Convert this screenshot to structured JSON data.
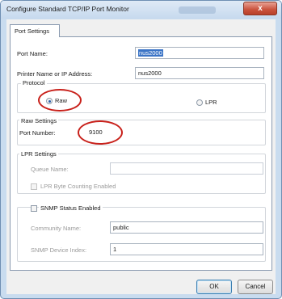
{
  "window": {
    "title": "Configure Standard TCP/IP Port Monitor",
    "close_glyph": "x"
  },
  "tabs": [
    {
      "label": "Port Settings",
      "selected": true
    }
  ],
  "port_settings": {
    "port_name_label": "Port Name:",
    "port_name_value": "nus2000",
    "printer_label": "Printer Name or IP Address:",
    "printer_value": "nus2000"
  },
  "protocol": {
    "group_title": "Protocol",
    "options": [
      {
        "label": "Raw",
        "selected": true
      },
      {
        "label": "LPR",
        "selected": false
      }
    ]
  },
  "raw_settings": {
    "group_title": "Raw Settings",
    "port_number_label": "Port Number:",
    "port_number_value": "9100"
  },
  "lpr_settings": {
    "group_title": "LPR Settings",
    "queue_name_label": "Queue Name:",
    "queue_name_value": "",
    "byte_counting_label": "LPR Byte Counting Enabled",
    "byte_counting_checked": false
  },
  "snmp": {
    "checkbox_label": "SNMP Status Enabled",
    "checked": false,
    "community_label": "Community Name:",
    "community_value": "public",
    "device_index_label": "SNMP Device Index:",
    "device_index_value": "1"
  },
  "buttons": {
    "ok_label": "OK",
    "cancel_label": "Cancel"
  },
  "colors": {
    "annotation": "#c8201a",
    "selection": "#3b74c6",
    "close_button": "#c9513b"
  }
}
